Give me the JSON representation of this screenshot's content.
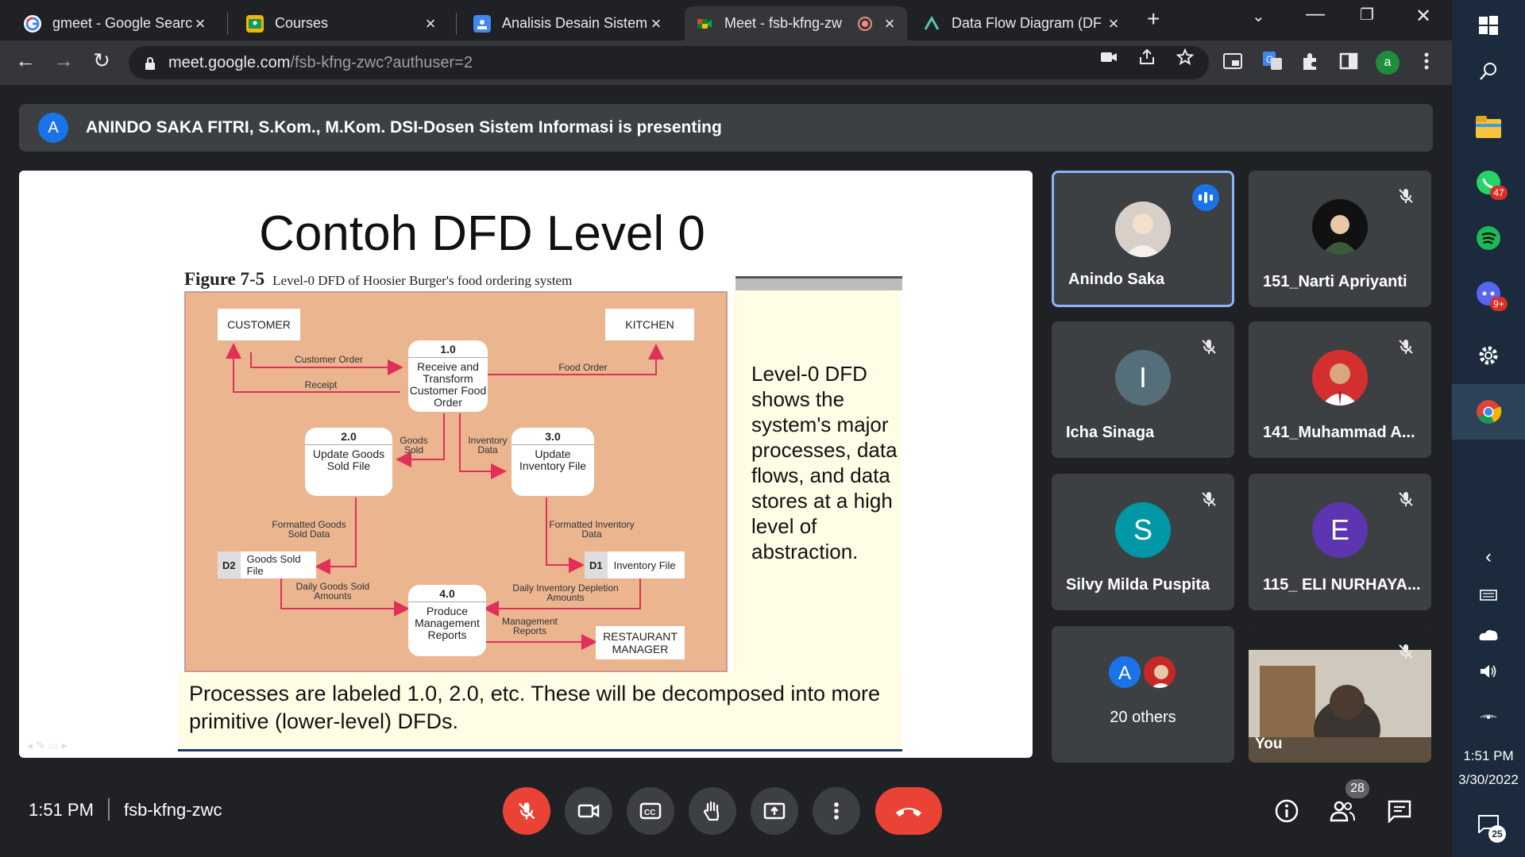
{
  "tabs": [
    {
      "title": "gmeet - Google Search",
      "icon": "google-icon"
    },
    {
      "title": "Courses",
      "icon": "classroom-icon"
    },
    {
      "title": "Analisis Desain Sistem I",
      "icon": "classroom-doc-icon"
    },
    {
      "title": "Meet - fsb-kfng-zw",
      "icon": "meet-icon",
      "active": true
    },
    {
      "title": "Data Flow Diagram (DF",
      "icon": "dfd-icon"
    }
  ],
  "omnibox": {
    "host": "meet.google.com",
    "path": "/fsb-kfng-zwc?authuser=2"
  },
  "profile_initial": "a",
  "banner": {
    "avatar": "A",
    "text": "ANINDO SAKA FITRI, S.Kom., M.Kom. DSI-Dosen Sistem Informasi is presenting"
  },
  "slide": {
    "title": "Contoh DFD Level 0",
    "figure_label": "Figure 7-5",
    "figure_caption": "Level-0 DFD of Hoosier Burger's food ordering system",
    "side_text": "Level-0 DFD shows the system's major processes, data flows, and data stores at a high level of abstraction.",
    "bottom_text": "Processes are labeled 1.0, 2.0, etc. These will be decomposed into more primitive (lower-level) DFDs.",
    "diagram": {
      "entities": {
        "customer": "CUSTOMER",
        "kitchen": "KITCHEN",
        "manager": "RESTAURANT MANAGER"
      },
      "processes": {
        "p1": {
          "num": "1.0",
          "label": "Receive and Transform Customer Food Order"
        },
        "p2": {
          "num": "2.0",
          "label": "Update Goods Sold File"
        },
        "p3": {
          "num": "3.0",
          "label": "Update Inventory File"
        },
        "p4": {
          "num": "4.0",
          "label": "Produce Management Reports"
        }
      },
      "stores": {
        "d2": {
          "id": "D2",
          "label": "Goods Sold File"
        },
        "d1": {
          "id": "D1",
          "label": "Inventory File"
        }
      },
      "flows": {
        "customer_order": "Customer Order",
        "receipt": "Receipt",
        "food_order": "Food Order",
        "goods_sold": "Goods Sold",
        "inventory_data": "Inventory Data",
        "formatted_goods": "Formatted Goods Sold Data",
        "formatted_inventory": "Formatted Inventory Data",
        "daily_goods": "Daily Goods Sold Amounts",
        "daily_inventory": "Daily Inventory Depletion Amounts",
        "mgmt_reports": "Management Reports"
      }
    }
  },
  "participants": [
    {
      "name": "Anindo Saka",
      "speaking": true,
      "avatar_type": "photo"
    },
    {
      "name": "151_Narti Apriyanti",
      "muted": true,
      "avatar_type": "photo"
    },
    {
      "name": "Icha Sinaga",
      "muted": true,
      "initial": "I",
      "color": "#546e7a"
    },
    {
      "name": "141_Muhammad A...",
      "muted": true,
      "avatar_type": "photo"
    },
    {
      "name": "Silvy Milda Puspita",
      "muted": true,
      "initial": "S",
      "color": "#0097a7"
    },
    {
      "name": "115_ ELI NURHAYA...",
      "muted": true,
      "initial": "E",
      "color": "#5e35b1"
    }
  ],
  "others": {
    "label": "20 others",
    "avatar_initial": "A"
  },
  "self_tile": {
    "label": "You"
  },
  "bottom": {
    "time": "1:51 PM",
    "meeting_code": "fsb-kfng-zwc",
    "participant_count": "28"
  },
  "taskbar": {
    "time": "1:51 PM",
    "date": "3/30/2022",
    "whatsapp_badge": "47",
    "discord_badge": "9+",
    "notif_count": "25"
  }
}
